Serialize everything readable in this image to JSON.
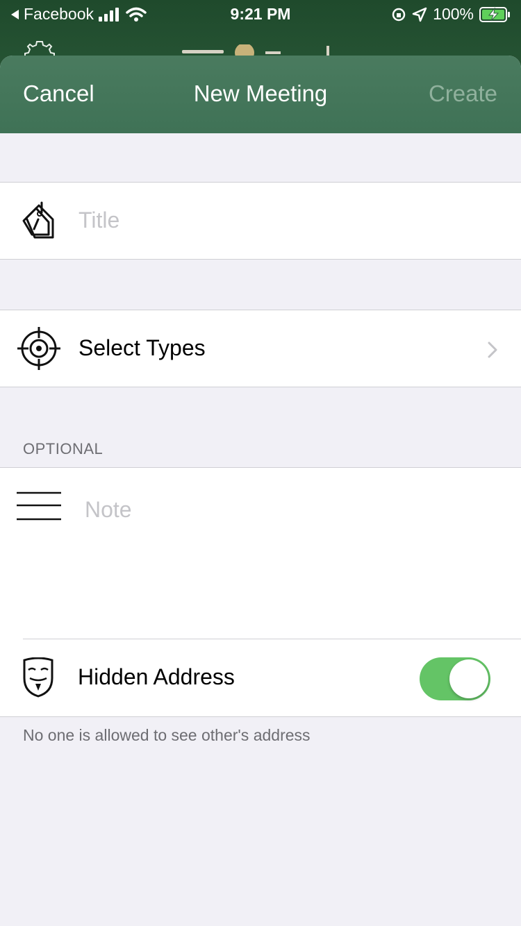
{
  "status_bar": {
    "back_app": "Facebook",
    "time": "9:21 PM",
    "battery": "100%"
  },
  "nav": {
    "cancel_label": "Cancel",
    "title": "New Meeting",
    "create_label": "Create"
  },
  "form": {
    "title_placeholder": "Title",
    "select_types_label": "Select Types",
    "optional_header": "OPTIONAL",
    "note_placeholder": "Note",
    "hidden_address_label": "Hidden Address",
    "hidden_address_on": true,
    "hidden_address_footer": "No one is allowed to see other's address"
  },
  "colors": {
    "nav_green": "#4a7b5f",
    "toggle_on": "#64c466",
    "create_disabled": "#90b19d",
    "placeholder": "#c4c4c8"
  },
  "icons": {
    "title": "tag-icon",
    "types": "crosshair-icon",
    "note": "lines-icon",
    "hidden_address": "mask-icon",
    "chevron": "chevron-right-icon"
  }
}
